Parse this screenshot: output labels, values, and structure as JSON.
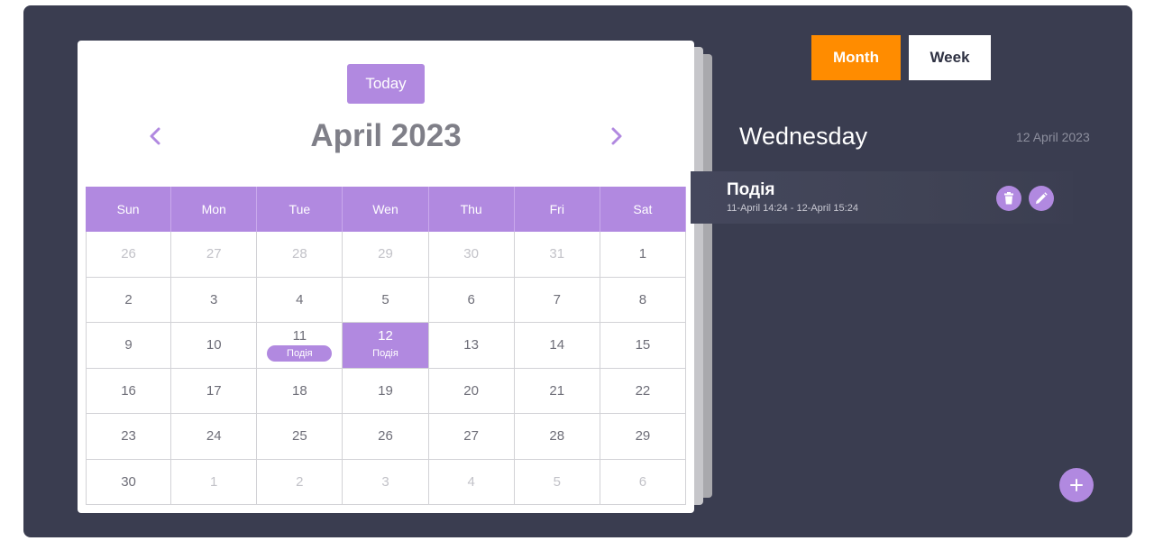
{
  "calendar": {
    "today_label": "Today",
    "month_title": "April 2023",
    "weekdays": [
      "Sun",
      "Mon",
      "Tue",
      "Wen",
      "Thu",
      "Fri",
      "Sat"
    ],
    "weeks": [
      [
        {
          "d": "26",
          "m": true
        },
        {
          "d": "27",
          "m": true
        },
        {
          "d": "28",
          "m": true
        },
        {
          "d": "29",
          "m": true
        },
        {
          "d": "30",
          "m": true
        },
        {
          "d": "31",
          "m": true
        },
        {
          "d": "1"
        }
      ],
      [
        {
          "d": "2"
        },
        {
          "d": "3"
        },
        {
          "d": "4"
        },
        {
          "d": "5"
        },
        {
          "d": "6"
        },
        {
          "d": "7"
        },
        {
          "d": "8"
        }
      ],
      [
        {
          "d": "9"
        },
        {
          "d": "10"
        },
        {
          "d": "11",
          "event": "Подія"
        },
        {
          "d": "12",
          "event": "Подія",
          "selected": true
        },
        {
          "d": "13"
        },
        {
          "d": "14"
        },
        {
          "d": "15"
        }
      ],
      [
        {
          "d": "16"
        },
        {
          "d": "17"
        },
        {
          "d": "18"
        },
        {
          "d": "19"
        },
        {
          "d": "20"
        },
        {
          "d": "21"
        },
        {
          "d": "22"
        }
      ],
      [
        {
          "d": "23"
        },
        {
          "d": "24"
        },
        {
          "d": "25"
        },
        {
          "d": "26"
        },
        {
          "d": "27"
        },
        {
          "d": "28"
        },
        {
          "d": "29"
        }
      ],
      [
        {
          "d": "30"
        },
        {
          "d": "1",
          "m": true
        },
        {
          "d": "2",
          "m": true
        },
        {
          "d": "3",
          "m": true
        },
        {
          "d": "4",
          "m": true
        },
        {
          "d": "5",
          "m": true
        },
        {
          "d": "6",
          "m": true
        }
      ]
    ]
  },
  "view_toggle": {
    "month_label": "Month",
    "week_label": "Week",
    "active": "Month"
  },
  "day_panel": {
    "weekday": "Wednesday",
    "date": "12 April 2023",
    "events": [
      {
        "title": "Подія",
        "time": "11-April 14:24 - 12-April 15:24"
      }
    ]
  },
  "colors": {
    "accent": "#b189e0",
    "active_toggle": "#ff8c00",
    "background": "#3a3d50"
  },
  "icons": {
    "prev": "chevron-left-icon",
    "next": "chevron-right-icon",
    "delete": "trash-icon",
    "edit": "pencil-icon",
    "add": "plus-icon"
  }
}
